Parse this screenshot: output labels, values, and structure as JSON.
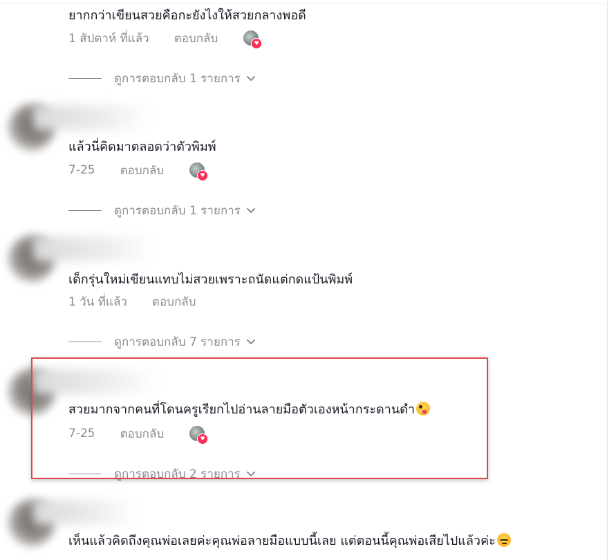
{
  "comments": [
    {
      "text": "ยากกว่าเขียนสวยคือกะยังไงให้สวยกลางพอดี",
      "time": "1 สัปดาห์ ที่แล้ว",
      "reply_label": "ตอบกลับ",
      "creator_liked": true,
      "view_replies": "ดูการตอบกลับ 1 รายการ"
    },
    {
      "text": "แล้วนี่คิดมาตลอดว่าตัวพิมพ์",
      "time": "7-25",
      "reply_label": "ตอบกลับ",
      "creator_liked": true,
      "view_replies": "ดูการตอบกลับ 1 รายการ"
    },
    {
      "text": "เด็กรุ่นใหม่เขียนแทบไม่สวยเพราะถนัดแต่กดแป้นพิมพ์",
      "time": "1 วัน ที่แล้ว",
      "reply_label": "ตอบกลับ",
      "creator_liked": false,
      "view_replies": "ดูการตอบกลับ 7 รายการ"
    },
    {
      "text": "สวยมากจากคนที่โดนครูเรียกไปอ่านลายมือตัวเองหน้ากระดานดำ",
      "emoji": "zany-face-emoji",
      "time": "7-25",
      "reply_label": "ตอบกลับ",
      "creator_liked": true,
      "view_replies": "ดูการตอบกลับ 2 รายการ",
      "highlighted": true
    },
    {
      "text": "เห็นแล้วคิดถึงคุณพ่อเลยค่ะคุณพ่อลายมือแบบนี้เลย แต่ตอนนี้คุณพ่อเสียไปแล้วค่ะ",
      "emoji": "pensive-face-emoji"
    }
  ],
  "colors": {
    "text": "#161823",
    "meta": "#8a8b91",
    "like_heart": "#fe2c55",
    "highlight_border": "#e0474c"
  },
  "icons": {
    "chevron": "chevron-down-icon",
    "heart": "heart-icon"
  }
}
